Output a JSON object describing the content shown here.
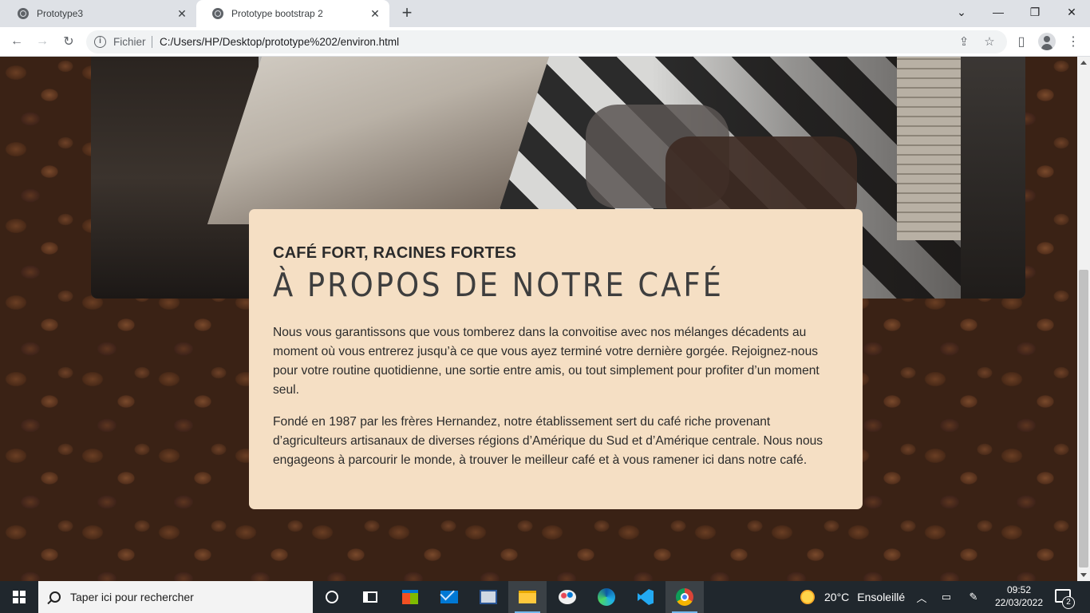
{
  "browser": {
    "tabs": [
      {
        "title": "Prototype3",
        "active": false
      },
      {
        "title": "Prototype bootstrap 2",
        "active": true
      }
    ],
    "address": {
      "scheme_label": "Fichier",
      "url": "C:/Users/HP/Desktop/prototype%202/environ.html"
    },
    "icons": {
      "back": "back-arrow-icon",
      "forward": "forward-arrow-icon",
      "reload": "reload-icon",
      "info": "info-icon",
      "share": "share-icon",
      "bookmark": "star-icon",
      "side_panel": "side-panel-icon",
      "profile": "profile-icon",
      "menu": "kebab-menu-icon",
      "minimize": "minimize-icon",
      "restore": "restore-icon",
      "close": "close-icon",
      "tab_search": "chevron-down-icon",
      "new_tab": "plus-icon"
    }
  },
  "page": {
    "about": {
      "subheading": "CAFÉ FORT, RACINES FORTES",
      "heading": "À PROPOS DE NOTRE CAFÉ",
      "paragraphs": [
        "Nous vous garantissons que vous tomberez dans la convoitise avec nos mélanges décadents au moment où vous entrerez jusqu’à ce que vous ayez terminé votre dernière gorgée. Rejoignez-nous pour votre routine quotidienne, une sortie entre amis, ou tout simplement pour profiter d’un moment seul.",
        "Fondé en 1987 par les frères Hernandez, notre établissement sert du café riche provenant d’agriculteurs artisanaux de diverses régions d’Amérique du Sud et d’Amérique centrale. Nous nous engageons à parcourir le monde, à trouver le meilleur café et à vous ramener ici dans notre café."
      ],
      "card_color": "#f5dfc4"
    }
  },
  "taskbar": {
    "search_placeholder": "Taper ici pour rechercher",
    "apps": [
      "cortana-icon",
      "task-view-icon",
      "store-icon",
      "mail-icon",
      "remote-desktop-icon",
      "file-explorer-icon",
      "paint-icon",
      "edge-icon",
      "vscode-icon",
      "chrome-icon"
    ],
    "weather": {
      "temperature": "20°C",
      "condition": "Ensoleillé"
    },
    "clock": {
      "time": "09:52",
      "date": "22/03/2022"
    },
    "notifications_count": "2"
  }
}
